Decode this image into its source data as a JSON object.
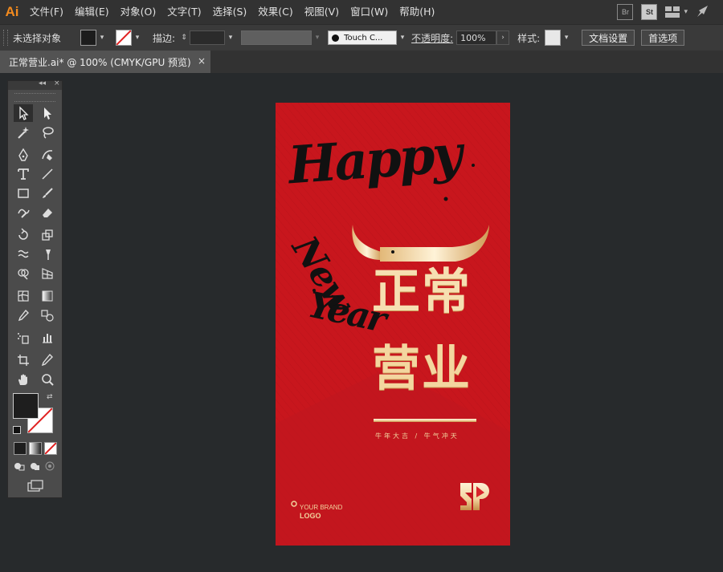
{
  "app": {
    "logo": "Ai"
  },
  "menu": [
    "文件(F)",
    "编辑(E)",
    "对象(O)",
    "文字(T)",
    "选择(S)",
    "效果(C)",
    "视图(V)",
    "窗口(W)",
    "帮助(H)"
  ],
  "menubar_icons": {
    "bridge": "Br",
    "stock": "St"
  },
  "control_bar": {
    "selection_label": "未选择对象",
    "stroke_label": "描边:",
    "brush_label": "Touch C...",
    "opacity_label": "不透明度:",
    "opacity_value": "100%",
    "style_label": "样式:",
    "doc_setup_button": "文档设置",
    "preferences_button": "首选项"
  },
  "document_tab": {
    "title": "正常营业.ai* @ 100% (CMYK/GPU 预览)",
    "close": "×"
  },
  "tool_panel": {
    "collapse": "◂◂",
    "close": "×"
  },
  "poster": {
    "script_line1": "Happy",
    "script_line2": "New",
    "script_line3": "Year",
    "title_line1": "正常",
    "title_line2": "营业",
    "subtitle": "牛年大吉 / 牛气冲天",
    "brand_line1": "YOUR BRAND",
    "brand_line2": "LOGO"
  },
  "colors": {
    "poster_red": "#c8161d",
    "gold_light": "#fbeccb",
    "gold_dark": "#c89a55",
    "ui_dark": "#323232",
    "canvas": "#272a2c",
    "logo_orange": "#f28a1e"
  }
}
